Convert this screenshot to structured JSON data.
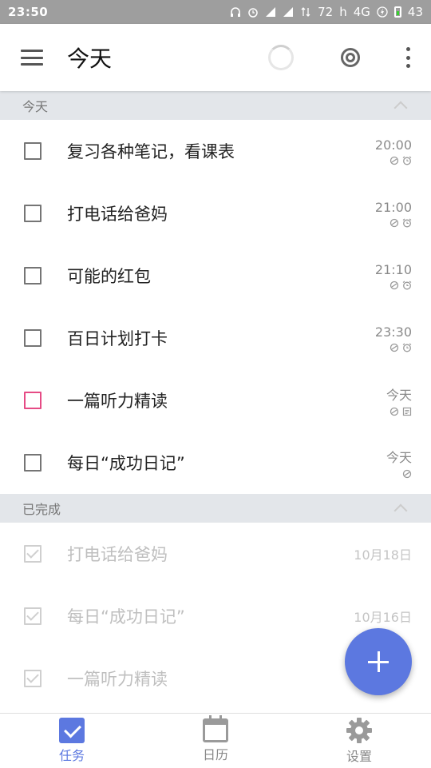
{
  "status_bar": {
    "time": "23:50",
    "network_speed": "72",
    "network_unit": "h",
    "network_type": "4G",
    "battery_level": "43"
  },
  "app_bar": {
    "title": "今天"
  },
  "sections": {
    "today": {
      "label": "今天",
      "tasks": [
        {
          "title": "复习各种笔记，看课表",
          "time": "20:00",
          "icons": [
            "repeat-icon",
            "alarm-icon"
          ],
          "checkbox_color": "#757575"
        },
        {
          "title": "打电话给爸妈",
          "time": "21:00",
          "icons": [
            "repeat-icon",
            "alarm-icon"
          ],
          "checkbox_color": "#757575"
        },
        {
          "title": "可能的红包",
          "time": "21:10",
          "icons": [
            "repeat-icon",
            "alarm-icon"
          ],
          "checkbox_color": "#757575"
        },
        {
          "title": "百日计划打卡",
          "time": "23:30",
          "icons": [
            "repeat-icon",
            "alarm-icon"
          ],
          "checkbox_color": "#757575"
        },
        {
          "title": "一篇听力精读",
          "time": "今天",
          "icons": [
            "repeat-icon",
            "note-icon"
          ],
          "checkbox_color": "#e64b85"
        },
        {
          "title": "每日“成功日记”",
          "time": "今天",
          "icons": [
            "repeat-icon"
          ],
          "checkbox_color": "#757575"
        }
      ]
    },
    "completed": {
      "label": "已完成",
      "tasks": [
        {
          "title": "打电话给爸妈",
          "time": "10月18日"
        },
        {
          "title": "每日“成功日记”",
          "time": "10月16日"
        },
        {
          "title": "一篇听力精读",
          "time": ""
        }
      ]
    }
  },
  "bottom_nav": {
    "items": [
      {
        "label": "任务",
        "icon": "tasks-icon",
        "active": true
      },
      {
        "label": "日历",
        "icon": "calendar-icon",
        "active": false
      },
      {
        "label": "设置",
        "icon": "gear-icon",
        "active": false
      }
    ]
  },
  "colors": {
    "accent": "#5c78e0",
    "section_bg": "#e3e6ea",
    "status_bar": "#9e9e9e",
    "pink_priority": "#e64b85"
  }
}
